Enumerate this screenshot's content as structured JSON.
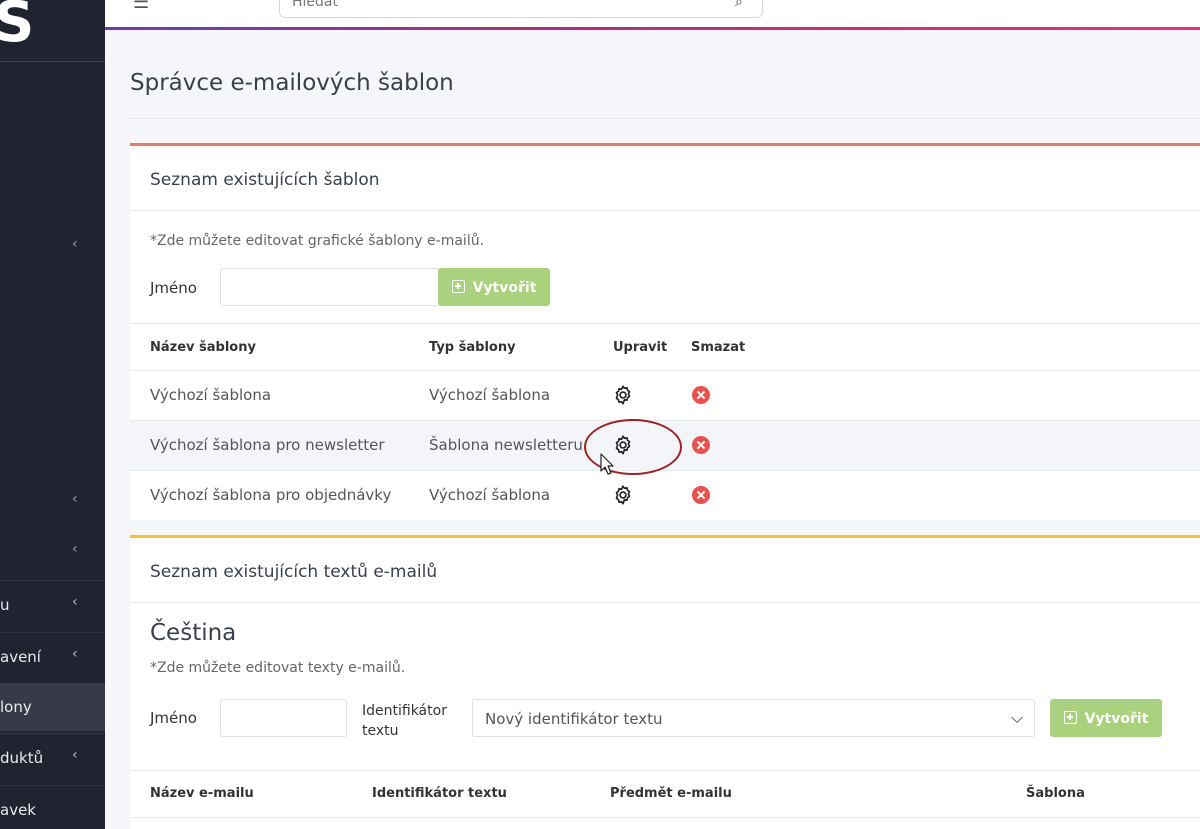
{
  "sidebar": {
    "logo": "S",
    "items": [
      {
        "label": "u",
        "active": false
      },
      {
        "label": "avení",
        "active": false
      },
      {
        "label": "lony",
        "active": true
      },
      {
        "label": "duktů",
        "active": false
      },
      {
        "label": "avek",
        "active": false
      }
    ]
  },
  "topbar": {
    "search_placeholder": "Hledat"
  },
  "page": {
    "title": "Správce e-mailových šablon"
  },
  "templates_card": {
    "title": "Seznam existujících šablon",
    "hint": "*Zde můžete editovat grafické šablony e-mailů.",
    "name_label": "Jméno",
    "name_value": "",
    "create_label": "Vytvořit",
    "columns": [
      "Název šablony",
      "Typ šablony",
      "Upravit",
      "Smazat"
    ],
    "rows": [
      {
        "name": "Výchozí šablona",
        "type": "Výchozí šablona"
      },
      {
        "name": "Výchozí šablona pro newsletter",
        "type": "Šablona newsletteru"
      },
      {
        "name": "Výchozí šablona pro objednávky",
        "type": "Výchozí šablona"
      }
    ]
  },
  "texts_card": {
    "title": "Seznam existujících textů e-mailů",
    "language": "Čeština",
    "hint": "*Zde můžete editovat texty e-mailů.",
    "name_label": "Jméno",
    "name_value": "",
    "identifier_label_line1": "Identifikátor",
    "identifier_label_line2": "textu",
    "identifier_selected": "Nový identifikátor textu",
    "create_label": "Vytvořit",
    "columns": [
      "Název e-mailu",
      "Identifikátor textu",
      "Předmět e-mailu",
      "Šablona"
    ]
  },
  "colors": {
    "sidebar_bg": "#1f2430",
    "create_button": "#a9d17e",
    "card1_accent": "#e87878",
    "card2_accent": "#f0c63c",
    "delete_icon": "#e8524e",
    "annotation": "#9b2323"
  }
}
